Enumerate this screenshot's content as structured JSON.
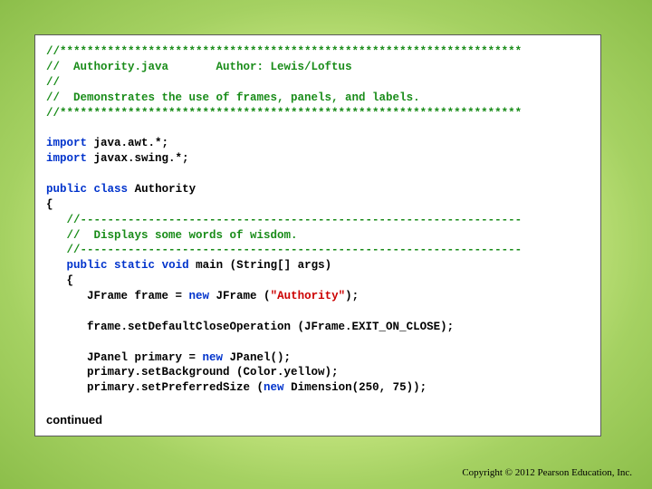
{
  "code": {
    "c1": "//********************************************************************",
    "c2a": "//  Authority.java",
    "c2b": "       Author: Lewis/Loftus",
    "c3": "//",
    "c4": "//  Demonstrates the use of frames, panels, and labels.",
    "c5": "//********************************************************************",
    "imp1a": "import",
    "imp1b": " java.awt.*;",
    "imp2a": "import",
    "imp2b": " javax.swing.*;",
    "pub": "public",
    "cls": "class",
    "clsname": "Authority",
    "lbrace": "{",
    "d1": "   //-----------------------------------------------------------------",
    "d2": "   //  Displays some words of wisdom.",
    "d3": "   //-----------------------------------------------------------------",
    "m1a": "   public",
    "m1b": "static",
    "m1c": "void",
    "m1d": " main (String[] args)",
    "m2": "   {",
    "l1a": "      JFrame frame = ",
    "l1b": "new",
    "l1c": " JFrame (",
    "l1d": "\"Authority\"",
    "l1e": ");",
    "l2": "      frame.setDefaultCloseOperation (JFrame.EXIT_ON_CLOSE);",
    "l3a": "      JPanel primary = ",
    "l3b": "new",
    "l3c": " JPanel();",
    "l4": "      primary.setBackground (Color.yellow);",
    "l5a": "      primary.setPreferredSize (",
    "l5b": "new",
    "l5c": " Dimension(250, 75));"
  },
  "footer": {
    "continued": "continued",
    "copyright": "Copyright © 2012 Pearson Education, Inc."
  }
}
